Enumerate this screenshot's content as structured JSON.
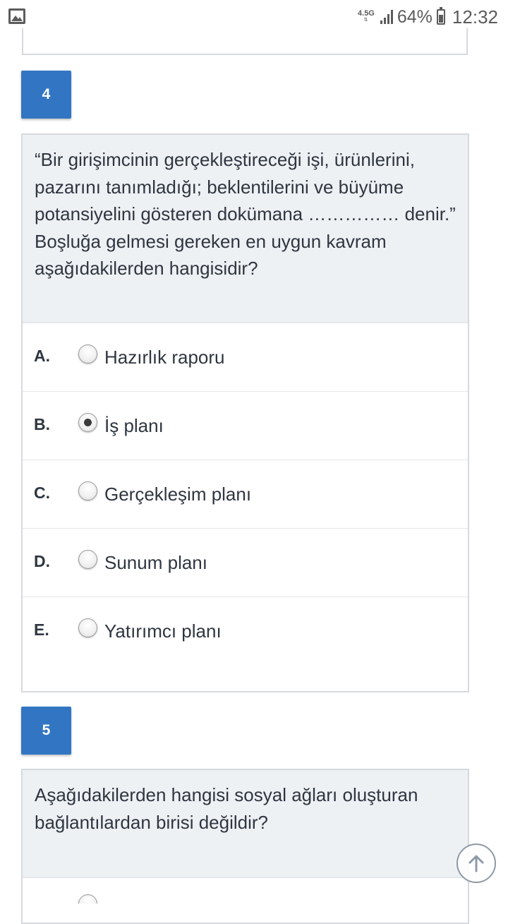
{
  "status_bar": {
    "network_type": "4.5G",
    "battery_percent": "64%",
    "time": "12:32",
    "icons": [
      "gallery-icon",
      "signal-icon",
      "battery-icon"
    ]
  },
  "questions": [
    {
      "number": "4",
      "text": "“Bir girişimcinin gerçekleştireceği işi, ürünlerini, pazarını tanımladığı; beklentilerini ve büyüme potansiyelini gösteren dokümana …………… denir.” Boşluğa gelmesi gereken en uygun kavram aşağıdakilerden hangisidir?",
      "options": [
        {
          "letter": "A.",
          "text": "Hazırlık raporu",
          "selected": false
        },
        {
          "letter": "B.",
          "text": "İş planı",
          "selected": true
        },
        {
          "letter": "C.",
          "text": "Gerçekleşim planı",
          "selected": false
        },
        {
          "letter": "D.",
          "text": "Sunum planı",
          "selected": false
        },
        {
          "letter": "E.",
          "text": "Yatırımcı planı",
          "selected": false
        }
      ]
    },
    {
      "number": "5",
      "text": "Aşağıdakilerden hangisi sosyal ağları oluşturan bağlantılardan birisi değildir?"
    }
  ],
  "scroll_top_icon": "arrow-up-icon"
}
